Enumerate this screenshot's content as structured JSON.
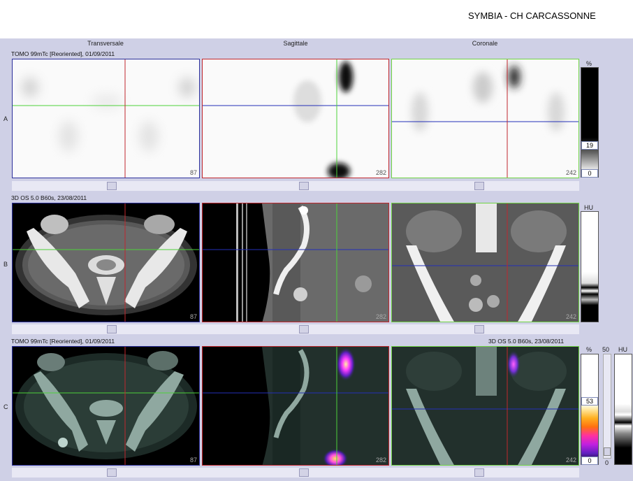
{
  "header": {
    "title": "SYMBIA - CH CARCASSONNE"
  },
  "columns": [
    "Transversale",
    "Sagittale",
    "Coronale"
  ],
  "rows": {
    "A": {
      "letter": "A",
      "info": "TOMO 99mTc [Reoriented], 01/09/2011",
      "slices": [
        "87",
        "282",
        "242"
      ]
    },
    "B": {
      "letter": "B",
      "info": "3D  OS  5.0  B60s, 23/08/2011",
      "slices": [
        "87",
        "282",
        "242"
      ]
    },
    "C": {
      "letter": "C",
      "info_left": "TOMO 99mTc [Reoriented], 01/09/2011",
      "info_right": "3D  OS  5.0  B60s, 23/08/2011",
      "slices": [
        "87",
        "282",
        "242"
      ]
    }
  },
  "colorbars": {
    "A": {
      "unit": "%",
      "top_value": "19",
      "bottom_value": "0"
    },
    "B": {
      "unit": "HU"
    },
    "C": {
      "unit_left": "%",
      "top_value": "53",
      "bottom_value": "0",
      "mid_label": "50",
      "low_label": "0",
      "unit_right": "HU"
    }
  },
  "colors": {
    "transversal_frame": "#2b2f9b",
    "sagittal_frame": "#c0272d",
    "coronal_frame": "#6fd443",
    "crosshair_vertical": "#c0272d",
    "crosshair_green": "#4ed13a",
    "crosshair_blue": "#2430b8",
    "panel_bg": "#cfd0e6"
  },
  "icons": [
    "scroll-thumb",
    "window-slider-knob"
  ]
}
